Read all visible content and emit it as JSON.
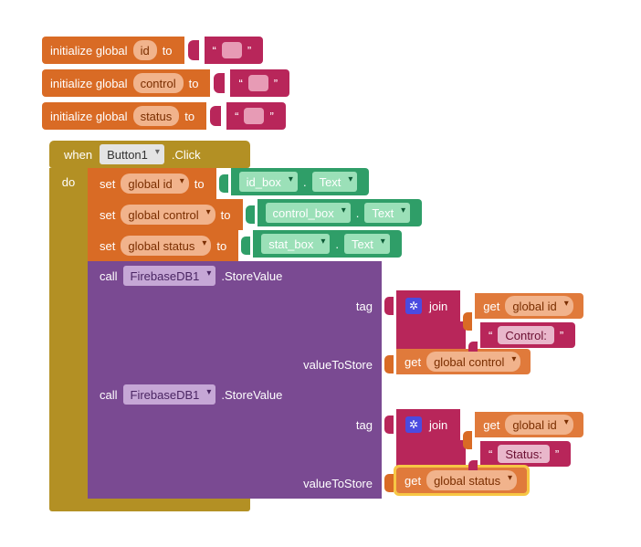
{
  "globals": [
    {
      "keyword": "initialize global",
      "name": "id",
      "to": "to",
      "value": ""
    },
    {
      "keyword": "initialize global",
      "name": "control",
      "to": "to",
      "value": ""
    },
    {
      "keyword": "initialize global",
      "name": "status",
      "to": "to",
      "value": ""
    }
  ],
  "event": {
    "when": "when",
    "component": "Button1",
    "event_name": ".Click",
    "do": "do",
    "sets": [
      {
        "set": "set",
        "var": "global id",
        "to": "to",
        "src_component": "id_box",
        "src_prop": "Text"
      },
      {
        "set": "set",
        "var": "global control",
        "to": "to",
        "src_component": "control_box",
        "src_prop": "Text"
      },
      {
        "set": "set",
        "var": "global status",
        "to": "to",
        "src_component": "stat_box",
        "src_prop": "Text"
      }
    ],
    "calls": [
      {
        "call": "call",
        "component": "FirebaseDB1",
        "method": ".StoreValue",
        "params": {
          "tag_label": "tag",
          "tag_join": {
            "join": "join",
            "parts": [
              {
                "kind": "get",
                "get": "get",
                "var": "global id"
              },
              {
                "kind": "str",
                "value": "Control:"
              }
            ]
          },
          "value_label": "valueToStore",
          "value_get": {
            "get": "get",
            "var": "global control",
            "highlight": false
          }
        }
      },
      {
        "call": "call",
        "component": "FirebaseDB1",
        "method": ".StoreValue",
        "params": {
          "tag_label": "tag",
          "tag_join": {
            "join": "join",
            "parts": [
              {
                "kind": "get",
                "get": "get",
                "var": "global id"
              },
              {
                "kind": "str",
                "value": "Status:"
              }
            ]
          },
          "value_label": "valueToStore",
          "value_get": {
            "get": "get",
            "var": "global status",
            "highlight": true
          }
        }
      }
    ]
  },
  "literals": {
    "dot": "."
  }
}
